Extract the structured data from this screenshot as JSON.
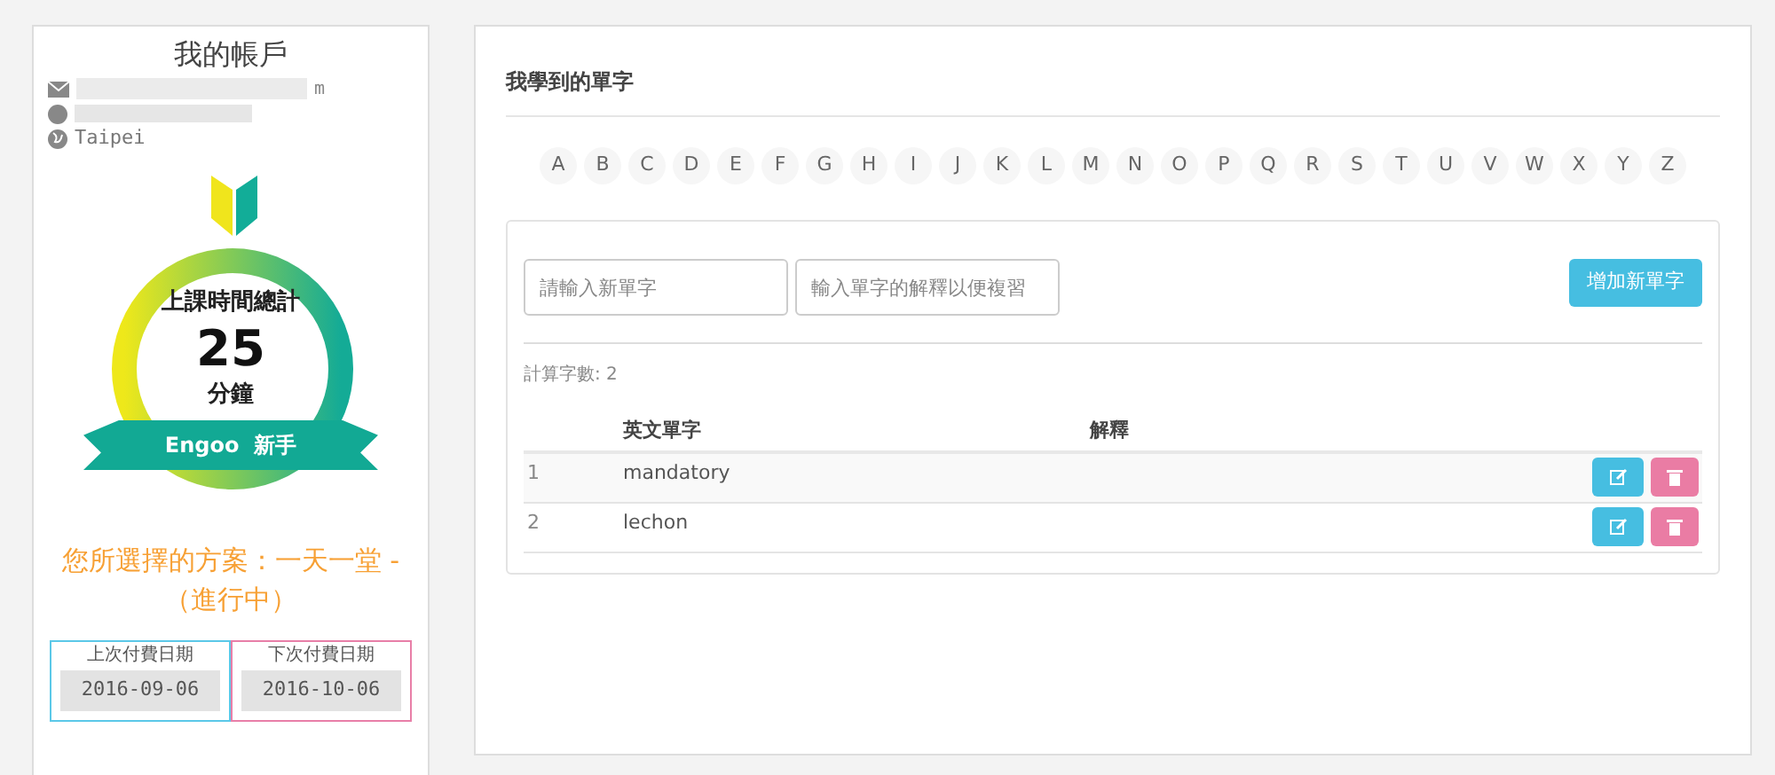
{
  "account": {
    "title": "我的帳戶",
    "email_visible": "m",
    "city": "Taipei"
  },
  "badge": {
    "label": "上課時間總計",
    "minutes": "25",
    "unit": "分鐘",
    "rank": "Engoo  新手"
  },
  "plan": {
    "text": "您所選擇的方案：一天一堂 -（進行中）"
  },
  "payments": [
    {
      "label": "上次付費日期",
      "date": "2016-09-06",
      "color": "#5bc8e8"
    },
    {
      "label": "下次付費日期",
      "date": "2016-10-06",
      "color": "#e87fa8"
    }
  ],
  "vocab": {
    "title": "我學到的單字",
    "letters": [
      "A",
      "B",
      "C",
      "D",
      "E",
      "F",
      "G",
      "H",
      "I",
      "J",
      "K",
      "L",
      "M",
      "N",
      "O",
      "P",
      "Q",
      "R",
      "S",
      "T",
      "U",
      "V",
      "W",
      "X",
      "Y",
      "Z"
    ],
    "word_input": {
      "placeholder": "請輸入新單字"
    },
    "meaning_input": {
      "placeholder": "輸入單字的解釋以便複習"
    },
    "add_button": "增加新單字",
    "count": "計算字數: 2",
    "columns": [
      "英文單字",
      "解釋"
    ],
    "rows": [
      {
        "index": "1",
        "word": "mandatory"
      },
      {
        "index": "2",
        "word": "lechon"
      }
    ]
  }
}
